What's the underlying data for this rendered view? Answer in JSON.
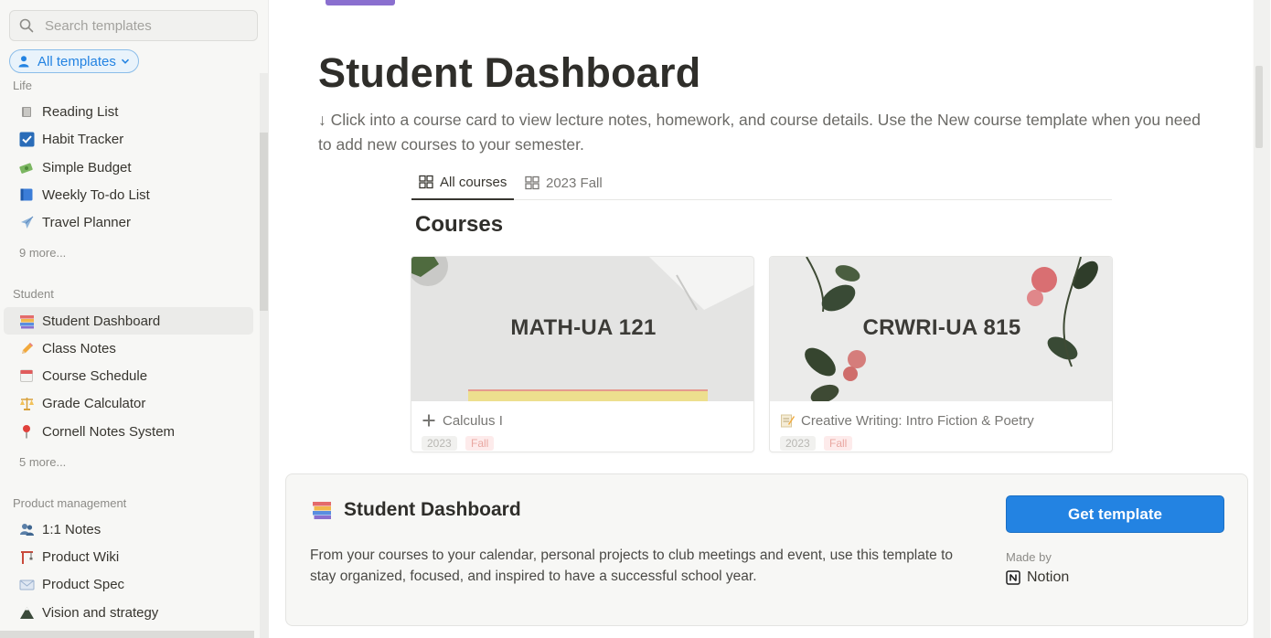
{
  "sidebar": {
    "search_placeholder": "Search templates",
    "filter_label": "All templates",
    "sections": {
      "life": {
        "label": "Life",
        "items": [
          {
            "label": "Reading List",
            "icon": "book-icon"
          },
          {
            "label": "Habit Tracker",
            "icon": "checkbox-icon"
          },
          {
            "label": "Simple Budget",
            "icon": "money-icon"
          },
          {
            "label": "Weekly To-do List",
            "icon": "blue-book-icon"
          },
          {
            "label": "Travel Planner",
            "icon": "airplane-icon"
          }
        ],
        "more": "9 more..."
      },
      "student": {
        "label": "Student",
        "items": [
          {
            "label": "Student Dashboard",
            "icon": "books-icon"
          },
          {
            "label": "Class Notes",
            "icon": "pencil-icon"
          },
          {
            "label": "Course Schedule",
            "icon": "calendar-icon"
          },
          {
            "label": "Grade Calculator",
            "icon": "scales-icon"
          },
          {
            "label": "Cornell Notes System",
            "icon": "pin-icon"
          }
        ],
        "more": "5 more..."
      },
      "product": {
        "label": "Product management",
        "items": [
          {
            "label": "1:1 Notes",
            "icon": "people-icon"
          },
          {
            "label": "Product Wiki",
            "icon": "crane-icon"
          },
          {
            "label": "Product Spec",
            "icon": "envelope-icon"
          },
          {
            "label": "Vision and strategy",
            "icon": "mountain-icon"
          }
        ]
      }
    }
  },
  "page": {
    "title": "Student Dashboard",
    "description": "↓ Click into a course card to view lecture notes, homework, and course details. Use the New course template when you need to add new courses to your semester.",
    "tabs": [
      {
        "label": "All courses"
      },
      {
        "label": "2023 Fall"
      }
    ],
    "courses_heading": "Courses",
    "cards": [
      {
        "code": "MATH-UA 121",
        "name": "Calculus I",
        "tags": [
          "2023",
          "Fall"
        ]
      },
      {
        "code": "CRWRI-UA 815",
        "name": "Creative Writing: Intro Fiction & Poetry",
        "tags": [
          "2023",
          "Fall"
        ]
      }
    ]
  },
  "panel": {
    "title": "Student Dashboard",
    "description": "From your courses to your calendar, personal projects to club meetings and event, use this template to stay organized, focused, and inspired to have a successful school year.",
    "button_label": "Get template",
    "made_by_label": "Made by",
    "maker": "Notion"
  },
  "colors": {
    "accent": "#2383e2",
    "text": "#37352f",
    "sidebar_bg": "#f7f7f5"
  }
}
